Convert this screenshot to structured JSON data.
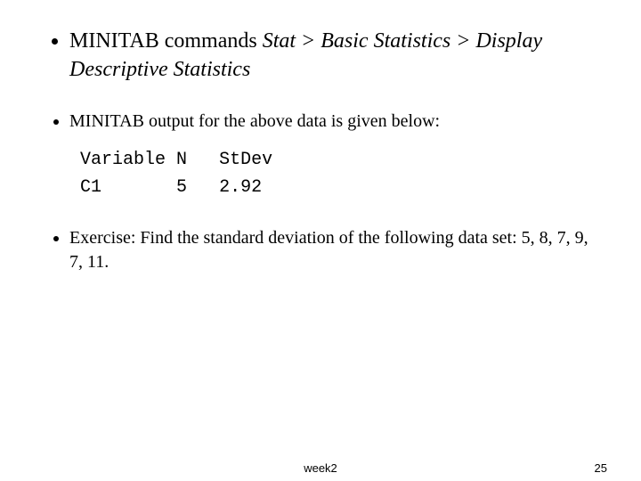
{
  "bullets": {
    "b1_plain": "MINITAB commands ",
    "b1_italic": "Stat > Basic Statistics > Display Descriptive Statistics",
    "b2": "MINITAB output for the above data is given below:",
    "b3": "Exercise: Find the standard deviation of the following data set: 5, 8, 7, 9, 7, 11."
  },
  "output_table": {
    "header": {
      "col1": "Variable",
      "col2": "N",
      "col3": "StDev"
    },
    "rows": [
      {
        "col1": "C1",
        "col2": "5",
        "col3": "2.92"
      }
    ]
  },
  "footer": {
    "center": "week2",
    "page": "25"
  }
}
